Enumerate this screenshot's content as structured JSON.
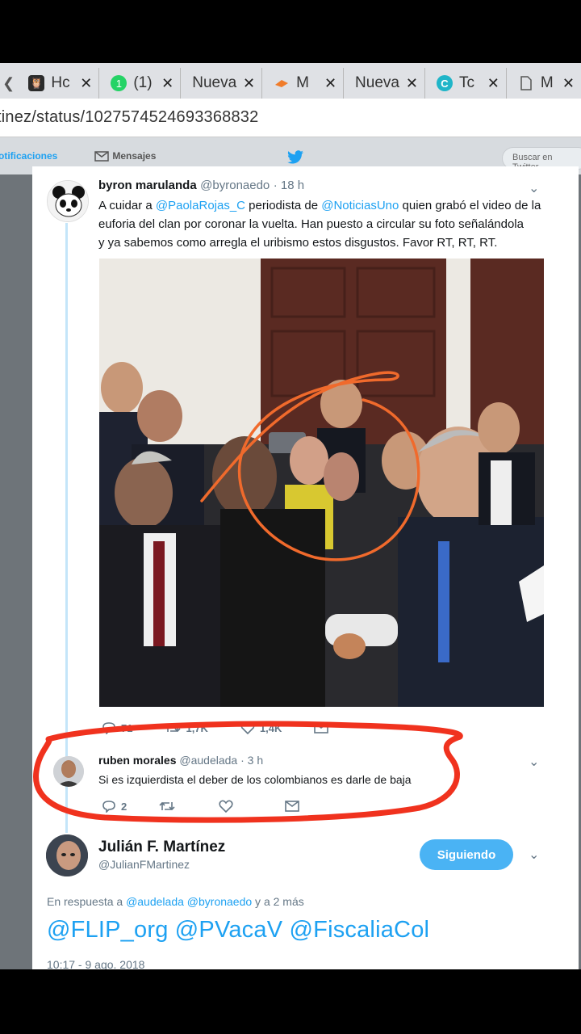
{
  "browser": {
    "tabs": [
      {
        "title": "Hc",
        "icon": "owl-icon",
        "color": "#333333"
      },
      {
        "title": "(1)",
        "icon": "whatsapp-icon",
        "color": "#25d366"
      },
      {
        "title": "Nueva",
        "icon": "",
        "color": ""
      },
      {
        "title": "M",
        "icon": "orange-logo-icon",
        "color": "#f07c2a"
      },
      {
        "title": "Nueva",
        "icon": "",
        "color": ""
      },
      {
        "title": "Tc",
        "icon": "c-circle-icon",
        "color": "#1fb5c8"
      },
      {
        "title": "M",
        "icon": "document-icon",
        "color": "#555555"
      }
    ],
    "url": "tinez/status/1027574524693368832"
  },
  "nav": {
    "notifications": "otificaciones",
    "messages": "Mensajes",
    "search_placeholder": "Buscar en Twitter"
  },
  "tweet1": {
    "name": "byron marulanda",
    "handle": "@byronaedo",
    "time": "· 18 h",
    "text_parts": {
      "a": "A cuidar a ",
      "m1": "@PaolaRojas_C",
      "b": " periodista de ",
      "m2": "@NoticiasUno",
      "c": " quien grabó el video de la",
      "line2": "euforia del clan por coronar la vuelta. Han puesto a circular su foto señalándola",
      "line3": "y ya sabemos como arregla el uribismo estos disgustos. Favor RT, RT, RT."
    },
    "replies": "71",
    "retweets": "1,7K",
    "likes": "1,4K"
  },
  "tweet2": {
    "name": "ruben morales",
    "handle": "@audelada",
    "time": "· 3 h",
    "text": "Si es izquierdista el deber de los colombianos es darle de baja",
    "replies": "2"
  },
  "main_tweet": {
    "name": "Julián F. Martínez",
    "handle": "@JulianFMartinez",
    "follow_label": "Siguiendo",
    "reply_prefix": "En respuesta a ",
    "reply_m1": "@audelada",
    "reply_m2": "@byronaedo",
    "reply_suffix": " y a 2 más",
    "text": "@FLIP_org @PVacaV @FiscaliaCol",
    "timestamp": "10:17 - 9 ago. 2018"
  },
  "colors": {
    "accent": "#1da1f2",
    "annotation_red": "#f0321e",
    "annotation_orange": "#f06a2c"
  }
}
